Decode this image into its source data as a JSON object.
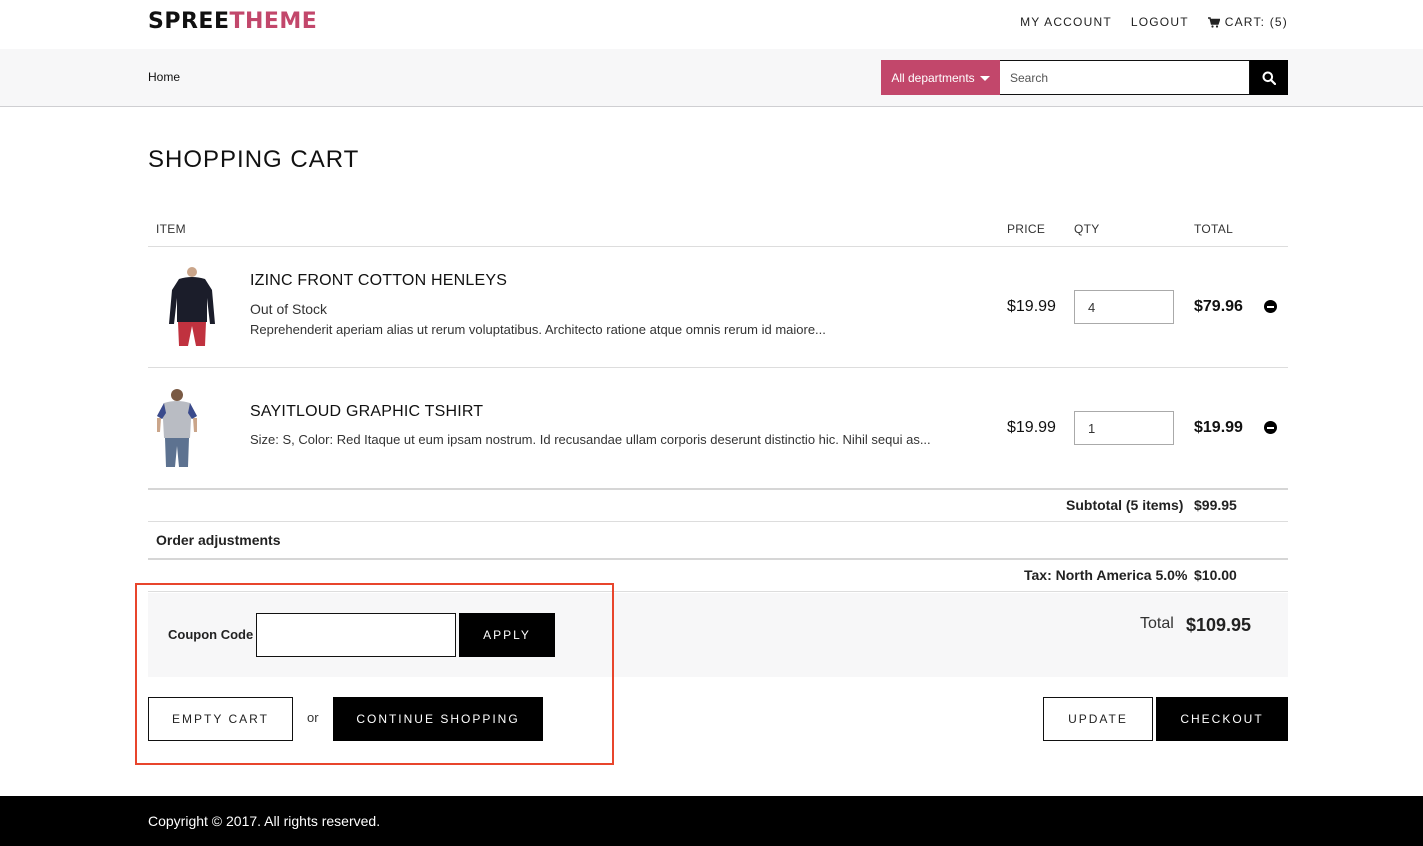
{
  "header": {
    "logo_part1": "SPREE",
    "logo_part2": "THEME",
    "nav": {
      "my_account": "MY ACCOUNT",
      "logout": "LOGOUT",
      "cart": "CART: (5)"
    }
  },
  "navbar": {
    "breadcrumb": "Home",
    "department_label": "All departments",
    "search_placeholder": "Search",
    "search_value": ""
  },
  "cart": {
    "title": "SHOPPING CART",
    "columns": {
      "item": "ITEM",
      "price": "PRICE",
      "qty": "QTY",
      "total": "TOTAL"
    },
    "items": [
      {
        "name": "IZINC FRONT COTTON HENLEYS",
        "stock": "Out of Stock",
        "description": "Reprehenderit aperiam alias ut rerum voluptatibus. Architecto ratione atque omnis rerum id maiore...",
        "price": "$19.99",
        "qty": "4",
        "total": "$79.96"
      },
      {
        "name": "SAYITLOUD GRAPHIC TSHIRT",
        "description": "Size: S, Color: Red Itaque ut eum ipsam nostrum. Id recusandae ullam corporis deserunt distinctio hic. Nihil sequi as...",
        "price": "$19.99",
        "qty": "1",
        "total": "$19.99"
      }
    ],
    "subtotal_label": "Subtotal (5 items)",
    "subtotal_value": "$99.95",
    "adjustments_label": "Order adjustments",
    "tax_label": "Tax: North America 5.0%",
    "tax_value": "$10.00",
    "coupon_label": "Coupon Code",
    "coupon_value": "",
    "apply_label": "APPLY",
    "total_label": "Total",
    "total_value": "$109.95",
    "empty_cart_label": "EMPTY CART",
    "or_text": "or",
    "continue_label": "CONTINUE SHOPPING",
    "update_label": "UPDATE",
    "checkout_label": "CHECKOUT"
  },
  "footer": {
    "copyright": "Copyright © 2017. All rights reserved."
  },
  "colors": {
    "accent": "#c2476b",
    "highlight": "#e8452c"
  }
}
